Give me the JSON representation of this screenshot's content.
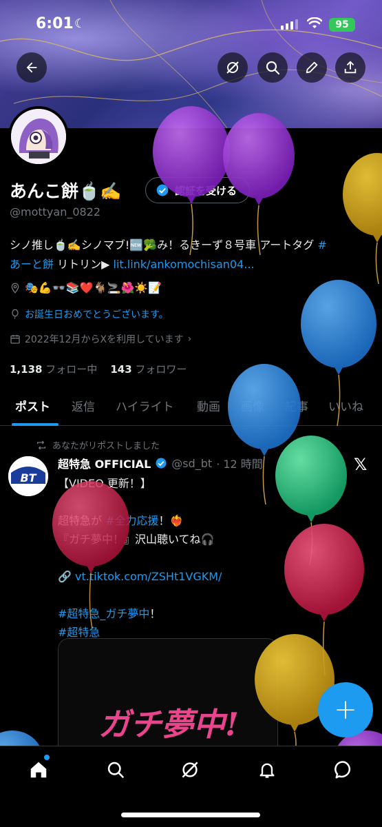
{
  "status_bar": {
    "time": "6:01",
    "battery": "95"
  },
  "profile": {
    "name": "あんこ餅🍵✍️",
    "handle": "@mottyan_0822",
    "verify_button": "認証を受ける",
    "bio_text": "シノ推し🍵✍️シノマブ!🆕🥦み！るきーず８号車 アートタグ ",
    "bio_hashtag": "#あーと餅",
    "bio_after": " リトリン▶ ",
    "bio_link": "lit.link/ankomochisan04...",
    "location_emojis": "🎭💪👓📚❤️🐐🚬🌺☀️📝",
    "birthday": "お誕生日おめでとうございます。",
    "joined": "2022年12月からXを利用しています",
    "following_count": "1,138",
    "following_label": "フォロー中",
    "followers_count": "143",
    "followers_label": "フォロワー"
  },
  "tabs": [
    "ポスト",
    "返信",
    "ハイライト",
    "動画",
    "画像",
    "記事",
    "いいね"
  ],
  "post": {
    "repost_note": "あなたがリポストしました",
    "author_name": "超特急 OFFICIAL",
    "author_handle": "@sd_bt",
    "time": "· 12 時間",
    "avatar_text": "BT",
    "line1": "【VIDEO 更新！】",
    "line2_prefix": "超特急が ",
    "line2_hashtag": "#全力応援",
    "line2_suffix": "！❤️‍🔥",
    "line3": "『ガチ夢中！』沢山聴いてね🎧",
    "link_prefix": "🔗 ",
    "link": "vt.tiktok.com/ZSHt1VGKM/",
    "hashtag1": "#超特急_ガチ夢中",
    "hashtag1_suffix": "！",
    "hashtag2": "#超特急",
    "media_text": "ガチ夢中!"
  },
  "fab_label": "+",
  "colors": {
    "accent": "#1d9bf0",
    "background": "#000000",
    "muted": "#71767b"
  },
  "icons": [
    "back-icon",
    "grok-icon",
    "search-icon",
    "pen-icon",
    "share-icon",
    "home-icon",
    "explore-icon",
    "grok-nav-icon",
    "bell-icon",
    "messages-icon"
  ]
}
